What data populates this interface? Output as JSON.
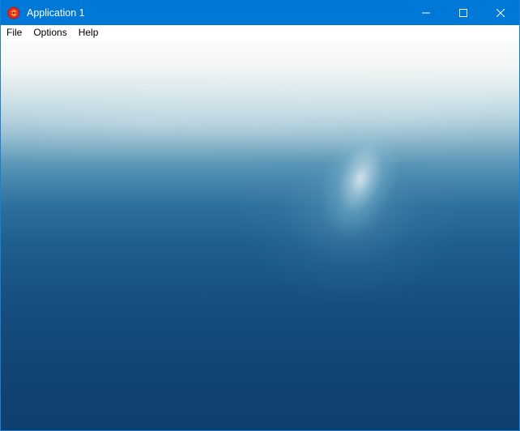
{
  "window": {
    "title": "Application 1",
    "app_icon": "red-round-app-icon",
    "controls": [
      "minimize-icon",
      "maximize-icon",
      "close-icon"
    ]
  },
  "menu": {
    "items": [
      {
        "label": "File"
      },
      {
        "label": "Options"
      },
      {
        "label": "Help"
      }
    ]
  },
  "viewport": {
    "scene": "ocean-with-fog",
    "colors": {
      "sky": "#fbfcfb",
      "fog": "#b2d0db",
      "water_mid": "#1e5f8e",
      "water_deep": "#0f3f6e"
    }
  },
  "colors": {
    "titlebar": "#0078d7",
    "title_text": "#ffffff"
  }
}
